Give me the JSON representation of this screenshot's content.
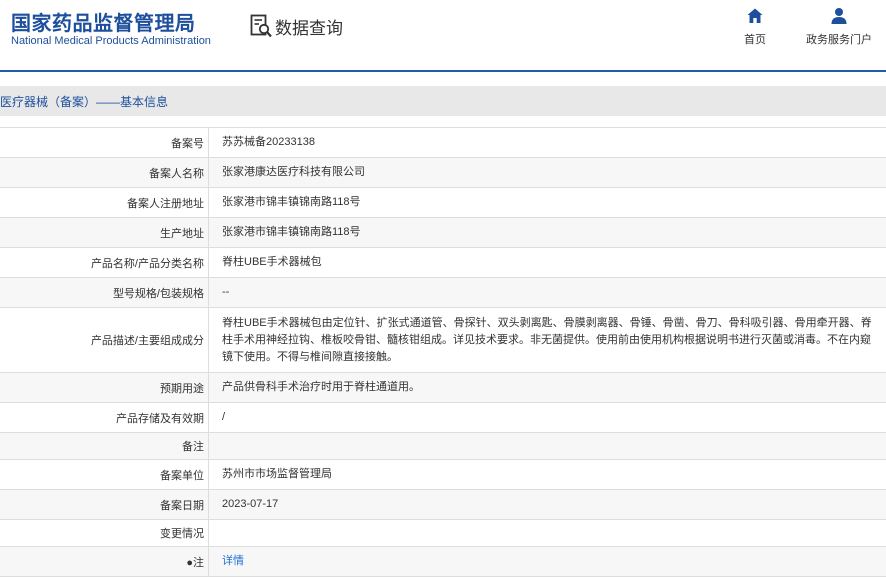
{
  "header": {
    "logo_cn": "国家药品监督管理局",
    "logo_en": "National Medical Products Administration",
    "query_label": "数据查询",
    "query_icon": "search-document-icon",
    "nav": [
      {
        "label": "首页",
        "icon": "home-icon"
      },
      {
        "label": "政务服务门户",
        "icon": "user-icon"
      }
    ],
    "brand_color": "#1d4f9c"
  },
  "section": {
    "title": "医疗器械（备案）——基本信息"
  },
  "table": {
    "rows": [
      {
        "label": "备案号",
        "value": "苏苏械备20233138"
      },
      {
        "label": "备案人名称",
        "value": "张家港康达医疗科技有限公司"
      },
      {
        "label": "备案人注册地址",
        "value": "张家港市锦丰镇锦南路118号"
      },
      {
        "label": "生产地址",
        "value": "张家港市锦丰镇锦南路118号"
      },
      {
        "label": "产品名称/产品分类名称",
        "value": "脊柱UBE手术器械包"
      },
      {
        "label": "型号规格/包装规格",
        "value": "--"
      },
      {
        "label": "产品描述/主要组成成分",
        "value": "脊柱UBE手术器械包由定位针、扩张式通道管、骨探针、双头剥离匙、骨膜剥离器、骨锤、骨凿、骨刀、骨科吸引器、骨用牵开器、脊柱手术用神经拉钩、椎板咬骨钳、髓核钳组成。详见技术要求。非无菌提供。使用前由使用机构根据说明书进行灭菌或消毒。不在内窥镜下使用。不得与椎间隙直接接触。"
      },
      {
        "label": "预期用途",
        "value": "产品供骨科手术治疗时用于脊柱通道用。"
      },
      {
        "label": "产品存储及有效期",
        "value": "/"
      },
      {
        "label": "备注",
        "value": ""
      },
      {
        "label": "备案单位",
        "value": "苏州市市场监督管理局"
      },
      {
        "label": "备案日期",
        "value": "2023-07-17"
      },
      {
        "label": "变更情况",
        "value": ""
      },
      {
        "label": "●注",
        "value": "详情"
      }
    ]
  }
}
